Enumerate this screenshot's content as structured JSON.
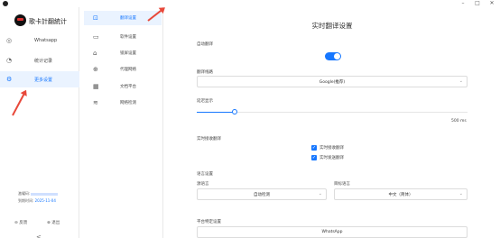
{
  "window": {
    "minimize": "–",
    "maximize": "□",
    "close": "✕"
  },
  "sidebar": {
    "brand": "歌卡計翻統计",
    "items": [
      {
        "label": "Whatsapp",
        "icon": "whatsapp-icon",
        "glyph": "◎"
      },
      {
        "label": "统计记录",
        "icon": "clock-icon",
        "glyph": "◔"
      },
      {
        "label": "更多设置",
        "icon": "gear-icon",
        "glyph": "⚙"
      }
    ],
    "member_label": "激耀码:",
    "expire_label": "到期时间:",
    "expire_date": "2025-11-04",
    "feedback": "反馈",
    "logout": "退出",
    "collapse": "<"
  },
  "subnav": {
    "items": [
      {
        "label": "翻译设置",
        "icon": "translate-icon",
        "glyph": "⊡"
      },
      {
        "label": "软件设置",
        "icon": "monitor-icon",
        "glyph": "▭"
      },
      {
        "label": "锁屏设置",
        "icon": "lock-icon",
        "glyph": "⌂"
      },
      {
        "label": "代理网络",
        "icon": "globe-icon",
        "glyph": "⊕"
      },
      {
        "label": "文档平台",
        "icon": "grid-icon",
        "glyph": "▦"
      },
      {
        "label": "网络检测",
        "icon": "wifi-icon",
        "glyph": "≋"
      }
    ]
  },
  "main": {
    "title": "实时翻译设置",
    "auto_translate_label": "自动翻译",
    "auto_translate_on": true,
    "engine_label": "翻译线路",
    "engine_value": "Google(推荐)",
    "delay_label": "延迟显示",
    "delay_value": 0.14,
    "delay_max": "500 ms",
    "realtime_label": "实时接收翻译",
    "realtime_options": [
      {
        "label": "实时接收翻译",
        "checked": true
      },
      {
        "label": "实时发送翻译",
        "checked": true
      }
    ],
    "lang_label": "语言设置",
    "source_label": "源语言",
    "source_value": "自动检测",
    "target_label": "目标语言",
    "target_value": "中文（简体）",
    "platform_label": "平台特定设置",
    "platform_value": "WhatsApp"
  },
  "colors": {
    "accent": "#1677ff",
    "annotation": "#e8483a"
  }
}
